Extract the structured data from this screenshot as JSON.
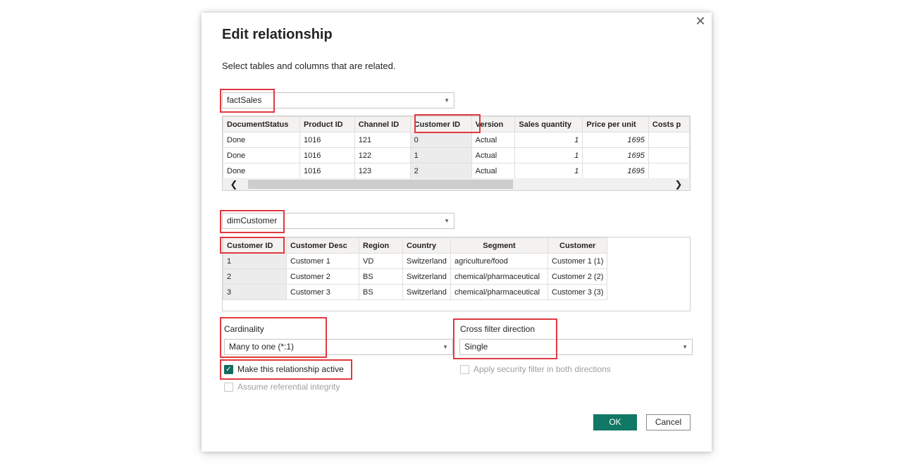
{
  "dialog": {
    "title": "Edit relationship",
    "close_icon": "close-icon",
    "subtitle": "Select tables and columns that are related."
  },
  "table1": {
    "selected": "factSales",
    "columns": [
      "DocumentStatus",
      "Product ID",
      "Channel ID",
      "Customer ID",
      "Version",
      "Sales quantity",
      "Price per unit",
      "Costs p"
    ],
    "rows": [
      [
        "Done",
        "1016",
        "121",
        "0",
        "Actual",
        "1",
        "1695",
        ""
      ],
      [
        "Done",
        "1016",
        "122",
        "1",
        "Actual",
        "1",
        "1695",
        ""
      ],
      [
        "Done",
        "1016",
        "123",
        "2",
        "Actual",
        "1",
        "1695",
        ""
      ]
    ],
    "scroll_left": "❮",
    "scroll_right": "❯"
  },
  "table2": {
    "selected": "dimCustomer",
    "columns": [
      "Customer ID",
      "Customer Desc",
      "Region",
      "Country",
      "Segment",
      "Customer"
    ],
    "rows": [
      [
        "1",
        "Customer 1",
        "VD",
        "Switzerland",
        "agriculture/food",
        "Customer 1 (1)"
      ],
      [
        "2",
        "Customer 2",
        "BS",
        "Switzerland",
        "chemical/pharmaceutical",
        "Customer 2 (2)"
      ],
      [
        "3",
        "Customer 3",
        "BS",
        "Switzerland",
        "chemical/pharmaceutical",
        "Customer 3 (3)"
      ]
    ]
  },
  "cardinality": {
    "label": "Cardinality",
    "value": "Many to one (*:1)"
  },
  "cross_filter": {
    "label": "Cross filter direction",
    "value": "Single"
  },
  "options": {
    "make_active": "Make this relationship active",
    "make_active_checked": true,
    "referential_integrity": "Assume referential integrity",
    "security_filter": "Apply security filter in both directions"
  },
  "buttons": {
    "ok": "OK",
    "cancel": "Cancel"
  },
  "colors": {
    "accent": "#117865",
    "highlight": "#e0393e"
  }
}
